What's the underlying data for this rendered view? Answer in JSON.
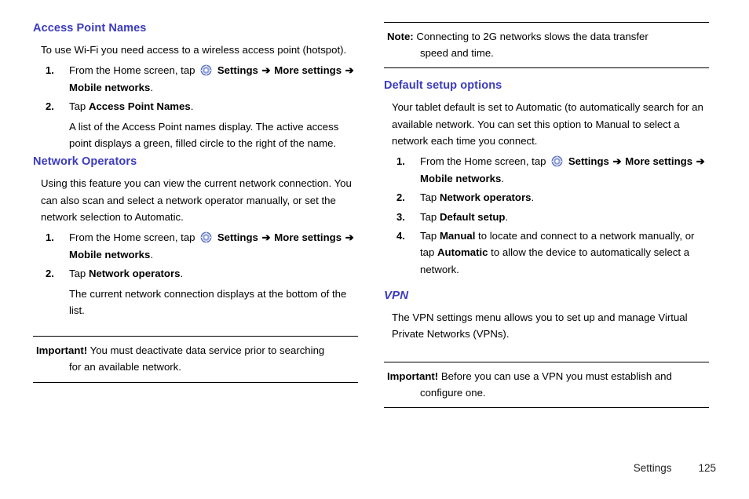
{
  "colors": {
    "heading": "#3b3bbf",
    "rule": "#000000"
  },
  "left": {
    "s1": {
      "heading": "Access Point Names",
      "intro": "To use Wi-Fi you need access to a wireless access point (hotspot).",
      "step1_pre": "From the Home screen, tap",
      "step1_settings": "Settings",
      "step1_more": "More settings",
      "step1_mobile": "Mobile networks",
      "step1_end": ".",
      "step2_pre": "Tap",
      "step2_bold": "Access Point Names",
      "step2_end": ".",
      "step2_sub": "A list of the Access Point names display. The active access point displays a green, filled circle to the right of the name."
    },
    "s2": {
      "heading": "Network Operators",
      "intro": "Using this feature you can view the current network connection. You can also scan and select a network operator manually, or set the network selection to Automatic.",
      "step1_pre": "From the Home screen, tap",
      "step1_settings": "Settings",
      "step1_more": "More settings",
      "step1_mobile": "Mobile networks",
      "step1_end": ".",
      "step2_pre": "Tap",
      "step2_bold": "Network operators",
      "step2_end": ".",
      "step2_sub": "The current network connection displays at the bottom of the list."
    },
    "note": {
      "label": "Important!",
      "text": "You must deactivate data service prior to searching",
      "cont": "for an available network."
    }
  },
  "right": {
    "note_top": {
      "label": "Note:",
      "text": "Connecting to 2G networks slows the data transfer",
      "cont": "speed and time."
    },
    "s1": {
      "heading": "Default setup options",
      "intro": "Your tablet default is set to Automatic (to automatically search for an available network. You can set this option to Manual to select a network each time you connect.",
      "step1_pre": "From the Home screen, tap",
      "step1_settings": "Settings",
      "step1_more": "More settings",
      "step1_mobile": "Mobile networks",
      "step1_end": ".",
      "step2_pre": "Tap",
      "step2_bold": "Network operators",
      "step2_end": ".",
      "step3_pre": "Tap",
      "step3_bold": "Default setup",
      "step3_end": ".",
      "step4_pre": "Tap",
      "step4_bold1": "Manual",
      "step4_mid": "to locate and connect to a network manually, or tap",
      "step4_bold2": "Automatic",
      "step4_end": "to allow the device to automatically select a network."
    },
    "s2": {
      "heading": "VPN",
      "intro": "The VPN settings menu allows you to set up and manage Virtual Private Networks (VPNs)."
    },
    "note": {
      "label": "Important!",
      "text": "Before you can use a VPN you must establish and",
      "cont": "configure one."
    }
  },
  "footer": {
    "label": "Settings",
    "page": "125"
  },
  "icons": {
    "settings": "settings-gear-icon",
    "arrow": "➔"
  }
}
